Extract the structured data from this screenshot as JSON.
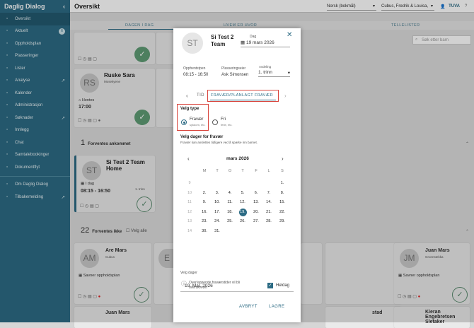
{
  "app": {
    "name": "Daglig Dialog"
  },
  "sidebar": {
    "items": [
      {
        "label": "Oversikt",
        "icon": "eye-icon",
        "active": true
      },
      {
        "label": "Aktuelt",
        "icon": "bell-icon",
        "badge": "6"
      },
      {
        "label": "Oppholdsplan",
        "icon": "calendar-icon"
      },
      {
        "label": "Plasseringer",
        "icon": "chair-icon"
      },
      {
        "label": "Lister",
        "icon": "printer-icon"
      },
      {
        "label": "Analyse",
        "icon": "chart-icon",
        "external": true
      },
      {
        "label": "Kalender",
        "icon": "calendar-icon"
      },
      {
        "label": "Administrasjon",
        "icon": "gear-icon"
      },
      {
        "label": "Søknader",
        "icon": "folder-icon",
        "external": true
      },
      {
        "label": "Innlegg",
        "icon": "pen-icon"
      },
      {
        "label": "Chat",
        "icon": "chat-icon"
      },
      {
        "label": "Samtalebookinger",
        "icon": "calendar-icon"
      },
      {
        "label": "Dokumentflyt",
        "icon": "document-icon"
      }
    ],
    "bottom": [
      {
        "label": "Om Daglig Dialog",
        "icon": "info-icon"
      },
      {
        "label": "Tilbakemelding",
        "icon": "feedback-icon",
        "external": true
      }
    ]
  },
  "header": {
    "title": "Oversikt",
    "language": "Norsk (bokmål)",
    "unit": "Cubus, Fredrik & Louisa,",
    "user": "TUVA"
  },
  "tabs": [
    "DAGEN I DAG",
    "HVEM ER HVOR",
    "TELLELISTER"
  ],
  "search": {
    "placeholder": "Søk etter barn"
  },
  "cards_top": [
    {
      "initials": "RS",
      "name": "Ruske Sara",
      "group": "Mosekyene",
      "status": "Hentes",
      "time": "17:00"
    }
  ],
  "section_arrivals": {
    "count": "1",
    "label": "Forventes ankommet"
  },
  "arrival_card": {
    "initials": "ST",
    "name": "Si Test 2 Team Home",
    "date": "I dag",
    "time": "08:15 - 16:50",
    "group": "1. trinn"
  },
  "section_absent": {
    "count": "22",
    "label": "Forventes ikke",
    "select_all": "Velg alle"
  },
  "absent_cards": [
    {
      "initials": "AM",
      "name": "Are Mars",
      "group": "Cubus",
      "status": "Savner oppholdsplan"
    },
    {
      "initials": "E",
      "name": "",
      "group": "",
      "status": ""
    },
    {
      "initials": "JM",
      "name": "Juan Mars",
      "group": "Gronnstekka",
      "status": "Savner oppholdsplan"
    }
  ],
  "bottom_cards": [
    "Juan Mars",
    "stad",
    "Kieran Engebretsen Sletaker"
  ],
  "modal": {
    "initials": "ST",
    "name": "Si Test 2 Team",
    "date_label": "Dag",
    "date": "19 mars 2026",
    "opening_label": "Opphentstpen",
    "opening": "08:15 - 16:50",
    "owner_label": "Plasseringseier",
    "owner": "Ask Simonsen",
    "department_label": "Avdeling",
    "department": "1. trinn",
    "tab_prev": "TID",
    "tab_active": "FRAVÆR/PLANLAGT FRAVÆR",
    "type_label": "Velg type",
    "types": [
      {
        "label": "Fravær",
        "sub": "sykdom, etc.",
        "selected": true
      },
      {
        "label": "Fri",
        "sub": "ferie, etc.",
        "selected": false
      }
    ],
    "days_title": "Velg dager for fravær",
    "days_hint": "Fravær kan anslettes tidligere ved å spørke inn barnet.",
    "month": "mars 2026",
    "weekdays": [
      "M",
      "T",
      "O",
      "T",
      "F",
      "L",
      "S"
    ],
    "weeks": [
      {
        "wk": "9",
        "days": [
          "",
          "",
          "",
          "",
          "",
          "",
          "1."
        ]
      },
      {
        "wk": "10",
        "days": [
          "2.",
          "3.",
          "4.",
          "5.",
          "6.",
          "7.",
          "8."
        ]
      },
      {
        "wk": "11",
        "days": [
          "9.",
          "10.",
          "11.",
          "12.",
          "13.",
          "14.",
          "15."
        ]
      },
      {
        "wk": "12",
        "days": [
          "16.",
          "17.",
          "18.",
          "19.",
          "20.",
          "21.",
          "22."
        ]
      },
      {
        "wk": "13",
        "days": [
          "23.",
          "24.",
          "25.",
          "26.",
          "27.",
          "28.",
          "29."
        ]
      },
      {
        "wk": "14",
        "days": [
          "30.",
          "31.",
          "",
          "",
          "",
          "",
          ""
        ]
      }
    ],
    "selected_day": "19.",
    "selected_label": "Velg dager",
    "selected_value": "19. Mar. 2026",
    "full_day_label": "Heldag",
    "full_day": true,
    "info": "Overlappende fraværstider vil bli overskrevet",
    "cancel": "AVBRYT",
    "save": "LAGRE"
  },
  "colors": {
    "sidebar": "#2c6b84",
    "accent": "#2c6b84",
    "highlight": "#d9453d",
    "check": "#5f9b74"
  }
}
